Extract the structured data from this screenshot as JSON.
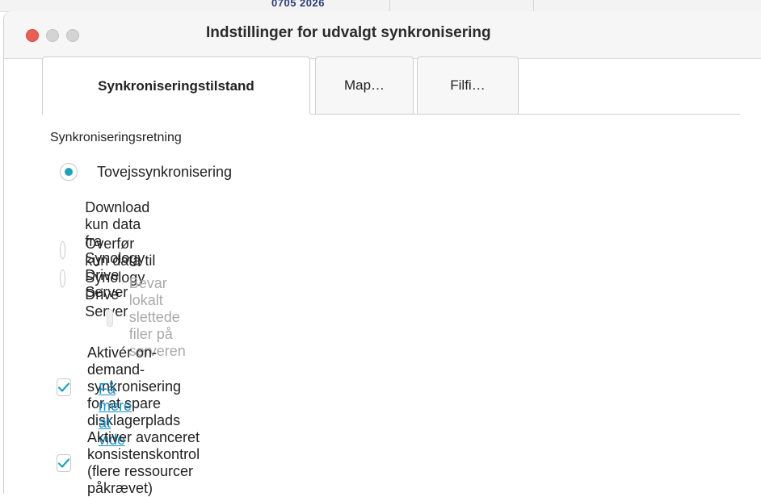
{
  "background_partial_text": "0705 2026",
  "window": {
    "title": "Indstillinger for udvalgt synkronisering"
  },
  "tabs": [
    {
      "label": "Synkroniseringstilstand",
      "active": true
    },
    {
      "label": "Map…",
      "active": false
    },
    {
      "label": "Filfi…",
      "active": false
    }
  ],
  "sync_direction": {
    "label": "Synkroniseringsretning",
    "options": [
      {
        "label": "Tovejssynkronisering",
        "selected": true
      },
      {
        "label": "Download kun data fra Synology Drive Server",
        "selected": false
      },
      {
        "label": "Overfør kun data til Synology Drive Server",
        "selected": false
      }
    ],
    "keep_deleted": {
      "label": "Bevar lokalt slettede filer på serveren",
      "checked": false,
      "disabled": true
    }
  },
  "on_demand": {
    "label": "Aktivér on-demand-synkronisering for at spare disklagerplads",
    "checked": true
  },
  "learn_more": "Få mere at vide",
  "consistency": {
    "label": "Aktiver avanceret konsistenskontrol (flere ressourcer påkrævet)",
    "checked": true
  },
  "colors": {
    "accent": "#1aa6b9",
    "link": "#1a8fc4",
    "close_light": "#ee5d52"
  }
}
